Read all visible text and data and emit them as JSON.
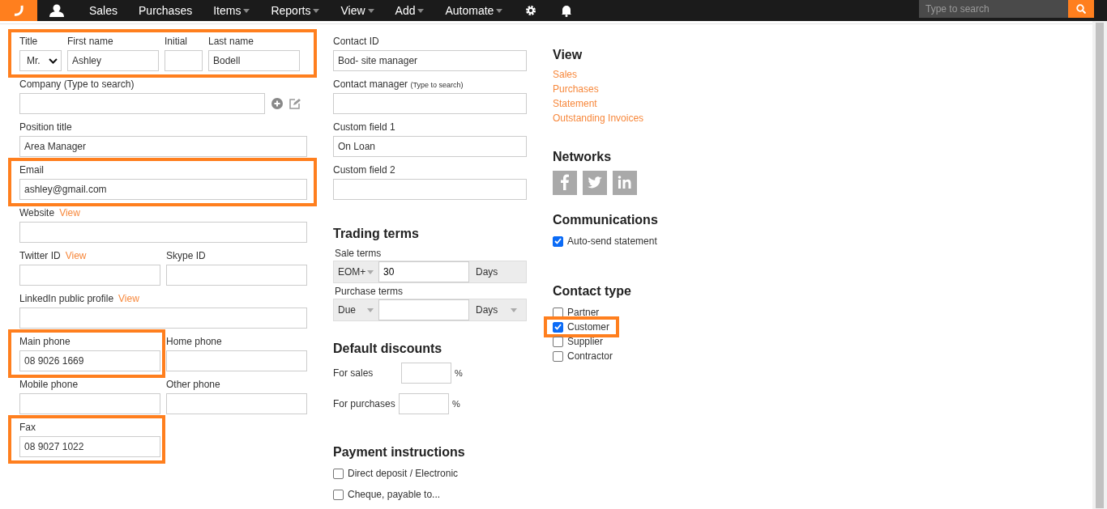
{
  "nav": {
    "menu": [
      {
        "label": "Sales",
        "dropdown": false
      },
      {
        "label": "Purchases",
        "dropdown": false
      },
      {
        "label": "Items",
        "dropdown": true
      },
      {
        "label": "Reports",
        "dropdown": true
      },
      {
        "label": "View",
        "dropdown": true
      },
      {
        "label": "Add",
        "dropdown": true
      },
      {
        "label": "Automate",
        "dropdown": true
      }
    ],
    "search": {
      "placeholder": "Type to search"
    }
  },
  "details": [
    {
      "highlighted": true,
      "fields": [
        {
          "kind": "select",
          "label": "Title",
          "value": "Mr.",
          "highlighted": false
        },
        {
          "kind": "name",
          "label": "First name",
          "value": "Ashley",
          "highlighted": false
        },
        {
          "kind": "narrow",
          "label": "Initial",
          "highlighted": false
        },
        {
          "kind": "name",
          "label": "Last name",
          "value": "Bodell",
          "highlighted": false
        }
      ]
    },
    {
      "highlighted": false,
      "fields": [
        {
          "kind": "company",
          "label": "Company (Type to search)",
          "highlighted": false
        }
      ]
    },
    {
      "highlighted": false,
      "fields": [
        {
          "kind": "full",
          "label": "Position title",
          "value": "Area Manager",
          "highlighted": false
        }
      ]
    },
    {
      "highlighted": true,
      "fields": [
        {
          "kind": "full",
          "label": "Email",
          "value": "ashley@gmail.com",
          "highlighted": false
        }
      ]
    },
    {
      "highlighted": false,
      "fields": [
        {
          "kind": "full",
          "label": "Website",
          "link": "View",
          "highlighted": false
        }
      ]
    },
    {
      "highlighted": false,
      "fields": [
        {
          "kind": "half",
          "label": "Twitter ID",
          "link": "View",
          "highlighted": false
        },
        {
          "kind": "half",
          "label": "Skype ID",
          "highlighted": false
        }
      ]
    },
    {
      "highlighted": false,
      "fields": [
        {
          "kind": "full",
          "label": "LinkedIn public profile",
          "link": "View",
          "highlighted": false
        }
      ]
    },
    {
      "highlighted": false,
      "fields": [
        {
          "kind": "half",
          "label": "Main phone",
          "value": "08 9026 1669",
          "highlighted": true
        },
        {
          "kind": "half",
          "label": "Home phone",
          "highlighted": false
        }
      ]
    },
    {
      "highlighted": false,
      "fields": [
        {
          "kind": "half",
          "label": "Mobile phone",
          "highlighted": false
        },
        {
          "kind": "half",
          "label": "Other phone",
          "highlighted": false
        }
      ]
    },
    {
      "highlighted": false,
      "fields": [
        {
          "kind": "half",
          "label": "Fax",
          "value": "08 9027 1022",
          "highlighted": true
        }
      ]
    }
  ],
  "extra_fields": [
    {
      "label": "Contact ID",
      "value": "Bod- site manager"
    },
    {
      "label": "Contact manager",
      "hint": "(Type to search)"
    },
    {
      "label": "Custom field 1",
      "value": "On Loan"
    },
    {
      "label": "Custom field 2"
    }
  ],
  "trading_terms": {
    "title": "Trading terms",
    "terms": [
      {
        "label": "Sale terms",
        "basis": "EOM+",
        "value": "30",
        "unit": "Days",
        "kind": "text"
      },
      {
        "label": "Purchase terms",
        "basis": "Due",
        "unit": "Days",
        "kind": "select"
      }
    ]
  },
  "default_discounts": {
    "title": "Default discounts",
    "rows": [
      {
        "label": "For sales",
        "unit": "%"
      },
      {
        "label": "For purchases",
        "unit": "%"
      }
    ]
  },
  "payment_instructions": {
    "title": "Payment instructions",
    "options": [
      {
        "label": "Direct deposit / Electronic",
        "checked": false
      },
      {
        "label": "Cheque, payable to...",
        "checked": false
      }
    ]
  },
  "view": {
    "title": "View",
    "links": [
      "Sales",
      "Purchases",
      "Statement",
      "Outstanding Invoices"
    ]
  },
  "networks": {
    "title": "Networks",
    "items": [
      {
        "kind": "facebook"
      },
      {
        "kind": "twitter"
      },
      {
        "kind": "linkedin"
      }
    ]
  },
  "communications": {
    "title": "Communications",
    "options": [
      {
        "label": "Auto-send statement",
        "checked": true
      }
    ]
  },
  "contact_type": {
    "title": "Contact type",
    "options": [
      {
        "label": "Partner",
        "checked": false,
        "highlighted": false
      },
      {
        "label": "Customer",
        "checked": true,
        "highlighted": true
      },
      {
        "label": "Supplier",
        "checked": false,
        "highlighted": false
      },
      {
        "label": "Contractor",
        "checked": false,
        "highlighted": false
      }
    ]
  }
}
